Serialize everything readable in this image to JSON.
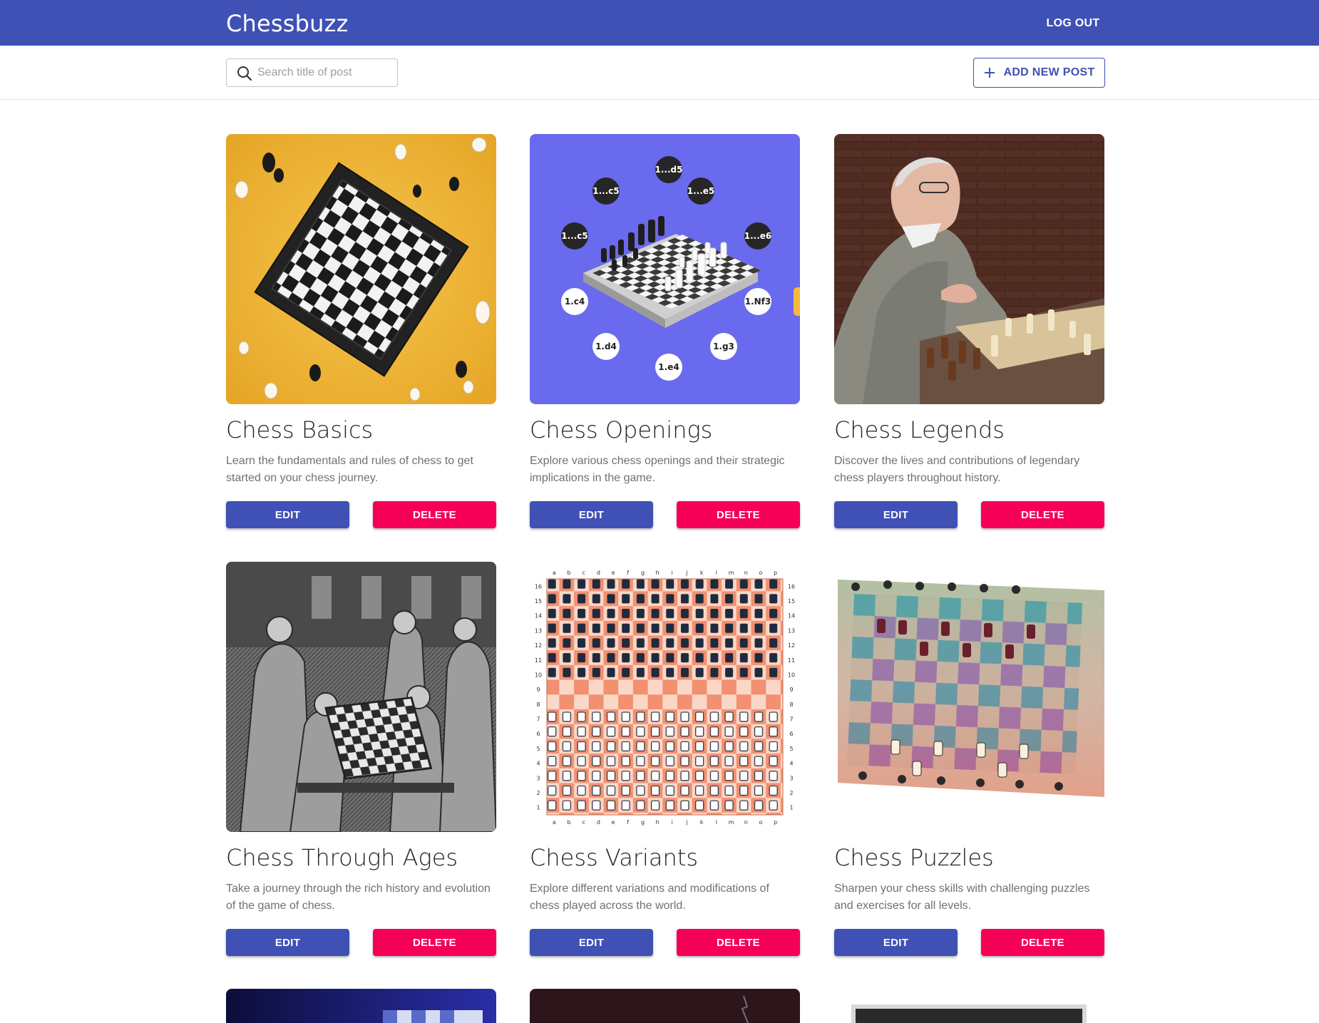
{
  "app": {
    "title": "Chessbuzz",
    "logout_label": "LOG OUT"
  },
  "toolbar": {
    "search_placeholder": "Search title of post",
    "add_post_label": "ADD NEW POST"
  },
  "posts": [
    {
      "title": "Chess Basics",
      "description": "Learn the fundamentals and rules of chess to get started on your chess journey.",
      "edit_label": "EDIT",
      "delete_label": "DELETE"
    },
    {
      "title": "Chess Openings",
      "description": "Explore various chess openings and their strategic implications in the game.",
      "edit_label": "EDIT",
      "delete_label": "DELETE"
    },
    {
      "title": "Chess Legends",
      "description": "Discover the lives and contributions of legendary chess players throughout history.",
      "edit_label": "EDIT",
      "delete_label": "DELETE"
    },
    {
      "title": "Chess Through Ages",
      "description": "Take a journey through the rich history and evolution of the game of chess.",
      "edit_label": "EDIT",
      "delete_label": "DELETE"
    },
    {
      "title": "Chess Variants",
      "description": "Explore different variations and modifications of chess played across the world.",
      "edit_label": "EDIT",
      "delete_label": "DELETE"
    },
    {
      "title": "Chess Puzzles",
      "description": "Sharpen your chess skills with challenging puzzles and exercises for all levels.",
      "edit_label": "EDIT",
      "delete_label": "DELETE"
    }
  ],
  "opening_moves": [
    "1...d5",
    "1...e5",
    "1...e6",
    "1.Nf3",
    "1.g3",
    "1.e4",
    "1.d4",
    "1.c4",
    "1...c5",
    "1...c5"
  ],
  "variant_board": {
    "files": [
      "a",
      "b",
      "c",
      "d",
      "e",
      "f",
      "g",
      "h",
      "i",
      "j",
      "k",
      "l",
      "m",
      "n",
      "o",
      "p"
    ],
    "ranks": [
      "16",
      "15",
      "14",
      "13",
      "12",
      "11",
      "10",
      "9",
      "8",
      "7",
      "6",
      "5",
      "4",
      "3",
      "2",
      "1"
    ]
  },
  "colors": {
    "primary": "#3f51b5",
    "secondary": "#f50057",
    "openings_bg": "#6a6aee",
    "basics_bg": "#f2b43a"
  }
}
